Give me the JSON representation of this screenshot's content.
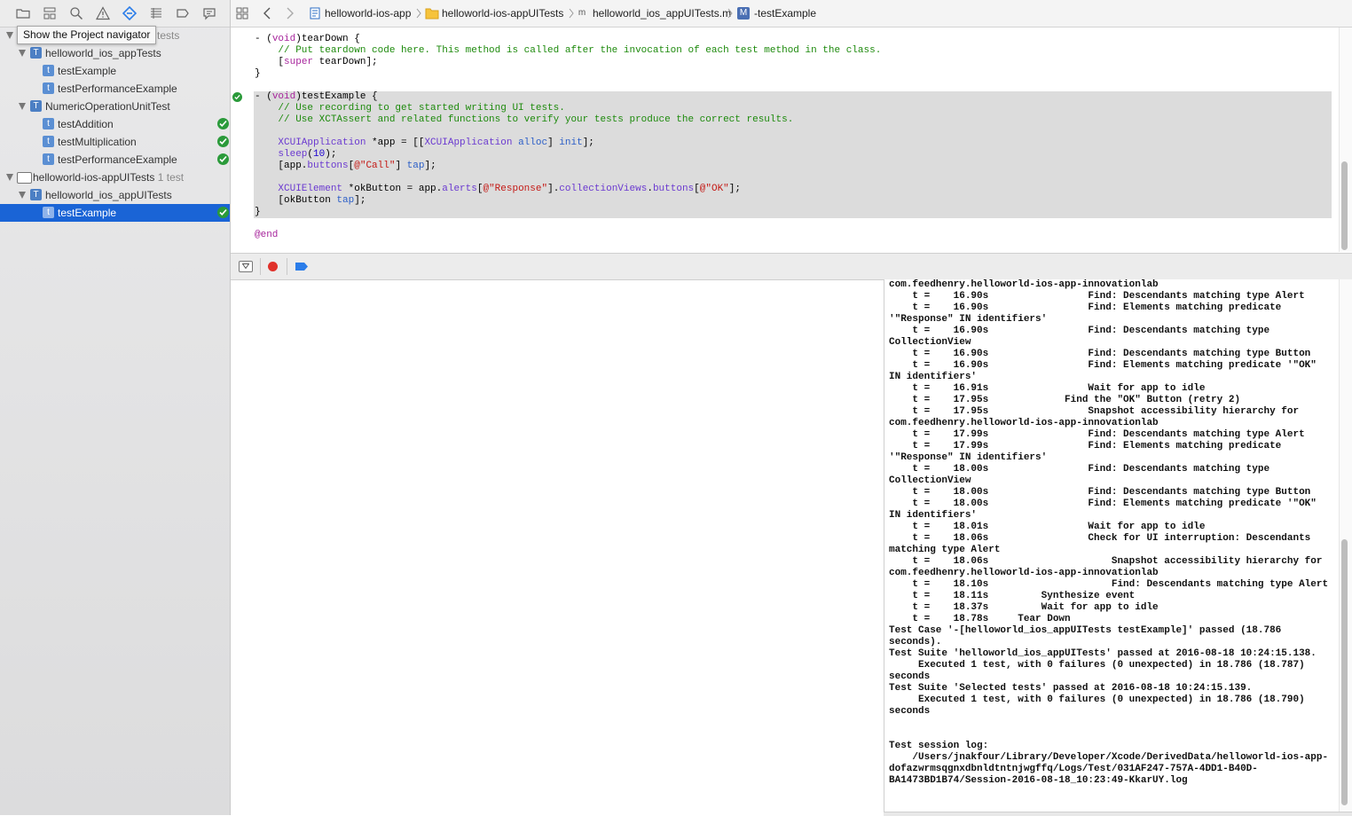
{
  "navigator": {
    "tooltip": "Show the Project navigator",
    "rows": [
      {
        "label": "tests",
        "note": ""
      },
      {
        "label": "helloworld_ios_appTests",
        "note": ""
      },
      {
        "label": "testExample",
        "note": ""
      },
      {
        "label": "testPerformanceExample",
        "note": ""
      },
      {
        "label": "NumericOperationUnitTest",
        "note": ""
      },
      {
        "label": "testAddition",
        "note": ""
      },
      {
        "label": "testMultiplication",
        "note": ""
      },
      {
        "label": "testPerformanceExample",
        "note": ""
      },
      {
        "label": "helloworld-ios-appUITests",
        "note": "1 test"
      },
      {
        "label": "helloworld_ios_appUITests",
        "note": ""
      },
      {
        "label": "testExample",
        "note": ""
      }
    ],
    "badge_letter": "t",
    "group_letter": "T"
  },
  "jumpbar": {
    "items": [
      "helloworld-ios-app",
      "helloworld-ios-appUITests",
      "helloworld_ios_appUITests.m",
      "-testExample"
    ],
    "file_badge": "m",
    "method_badge": "M"
  },
  "editor": {
    "tearDown_sig_a": "- (",
    "tearDown_sig_void": "void",
    "tearDown_sig_b": ")tearDown {",
    "tearDown_comment": "    // Put teardown code here. This method is called after the invocation of each test method in the class.",
    "super_indent": "    [",
    "super_kw": "super",
    "super_rest": " tearDown];",
    "brace": "}",
    "test_sig_a": "- (",
    "test_sig_void": "void",
    "test_sig_b": ")testExample {",
    "comment1": "    // Use recording to get started writing UI tests.",
    "comment2": "    // Use XCTAssert and related functions to verify your tests produce the correct results.",
    "app_indent": "    ",
    "app_cls": "XCUIApplication",
    "app_mid": " *app = [[",
    "app_cls2": "XCUIApplication",
    "app_alloc": " alloc",
    "app_init_a": "] ",
    "app_init": "init",
    "app_end": "];",
    "sleep_indent": "    ",
    "sleep_fn": "sleep",
    "sleep_open": "(",
    "sleep_num": "10",
    "sleep_close": ");",
    "tap_a": "    [app.",
    "tap_buttons": "buttons",
    "tap_b": "[",
    "tap_str": "@\"Call\"",
    "tap_c": "] ",
    "tap_m": "tap",
    "tap_d": "];",
    "ok_indent": "    ",
    "ok_cls": "XCUIElement",
    "ok_a": " *okButton = app.",
    "ok_alerts": "alerts",
    "ok_b": "[",
    "ok_str1": "@\"Response\"",
    "ok_c": "].",
    "ok_cv": "collectionViews",
    "ok_d": ".",
    "ok_buttons": "buttons",
    "ok_e": "[",
    "ok_str2": "@\"OK\"",
    "ok_f": "];",
    "okt_a": "    [okButton ",
    "okt_m": "tap",
    "okt_b": "];",
    "brace2": "}",
    "end": "@end"
  },
  "console": {
    "lines": [
      "com.feedhenry.helloworld-ios-app-innovationlab",
      "    t =    16.90s                 Find: Descendants matching type Alert",
      "    t =    16.90s                 Find: Elements matching predicate",
      "'\"Response\" IN identifiers'",
      "    t =    16.90s                 Find: Descendants matching type",
      "CollectionView",
      "    t =    16.90s                 Find: Descendants matching type Button",
      "    t =    16.90s                 Find: Elements matching predicate '\"OK\"",
      "IN identifiers'",
      "    t =    16.91s                 Wait for app to idle",
      "    t =    17.95s             Find the \"OK\" Button (retry 2)",
      "    t =    17.95s                 Snapshot accessibility hierarchy for",
      "com.feedhenry.helloworld-ios-app-innovationlab",
      "    t =    17.99s                 Find: Descendants matching type Alert",
      "    t =    17.99s                 Find: Elements matching predicate",
      "'\"Response\" IN identifiers'",
      "    t =    18.00s                 Find: Descendants matching type",
      "CollectionView",
      "    t =    18.00s                 Find: Descendants matching type Button",
      "    t =    18.00s                 Find: Elements matching predicate '\"OK\"",
      "IN identifiers'",
      "    t =    18.01s                 Wait for app to idle",
      "    t =    18.06s                 Check for UI interruption: Descendants",
      "matching type Alert",
      "    t =    18.06s                     Snapshot accessibility hierarchy for",
      "com.feedhenry.helloworld-ios-app-innovationlab",
      "    t =    18.10s                     Find: Descendants matching type Alert",
      "    t =    18.11s         Synthesize event",
      "    t =    18.37s         Wait for app to idle",
      "    t =    18.78s     Tear Down",
      "Test Case '-[helloworld_ios_appUITests testExample]' passed (18.786",
      "seconds).",
      "Test Suite 'helloworld_ios_appUITests' passed at 2016-08-18 10:24:15.138.",
      "     Executed 1 test, with 0 failures (0 unexpected) in 18.786 (18.787)",
      "seconds",
      "Test Suite 'Selected tests' passed at 2016-08-18 10:24:15.139.",
      "     Executed 1 test, with 0 failures (0 unexpected) in 18.786 (18.790)",
      "seconds",
      "",
      "",
      "Test session log:",
      "    /Users/jnakfour/Library/Developer/Xcode/DerivedData/helloworld-ios-app-",
      "dofazwrmsqgnxdbnldtntnjwgffq/Logs/Test/031AF247-757A-4DD1-B40D-",
      "BA1473BD1B74/Session-2016-08-18_10:23:49-KkarUY.log"
    ]
  },
  "colors": {
    "selection": "#1a64d6",
    "pass": "#2a9a3a",
    "breakpoint": "#e0312b",
    "location": "#2b7de9"
  }
}
